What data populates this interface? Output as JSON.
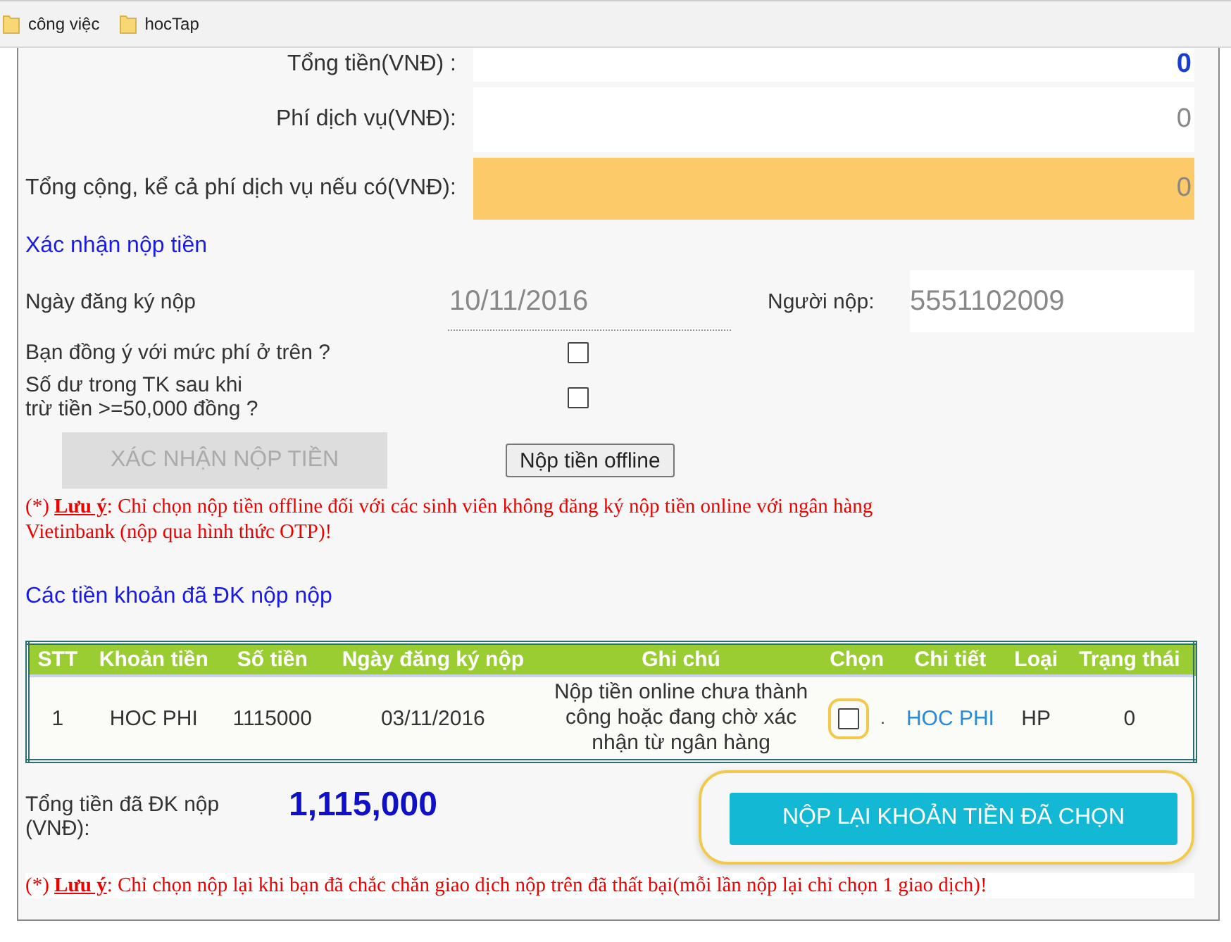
{
  "bookmarks": [
    {
      "label": "công việc"
    },
    {
      "label": "hocTap"
    }
  ],
  "amount_rows": [
    {
      "label": "Tổng tiền(VNĐ) :",
      "value": "0",
      "kind": "plain"
    },
    {
      "label": "Phí dịch vụ(VNĐ):",
      "value": "0",
      "kind": "plain"
    },
    {
      "label": "Tổng cộng, kể cả phí dịch vụ nếu có(VNĐ):",
      "value": "0",
      "kind": "total"
    }
  ],
  "confirm_heading": "Xác nhận nộp tiền",
  "register_date": {
    "label": "Ngày đăng ký nộp",
    "value": "10/11/2016"
  },
  "payer": {
    "label": "Người nộp:",
    "value": "5551102009"
  },
  "agreements": [
    {
      "label": "Bạn đồng ý với mức phí ở trên ?",
      "checked": false
    },
    {
      "label": "Số dư trong TK sau khi\ntrừ tiền >=50,000 đồng ?",
      "checked": false
    }
  ],
  "confirm_button": {
    "label": "XÁC NHẬN NỘP TIỀN",
    "disabled": true
  },
  "offline_button": {
    "label": "Nộp tiền offline",
    "disabled": false
  },
  "note_1": "(*) **Lưu ý**: Chỉ chọn nộp tiền offline đối với các sinh viên không đăng ký nộp tiền online với ngân hàng Vietinbank (nộp qua hình thức OTP)!",
  "registered_heading": "Các tiền khoản đã ĐK nộp nộp",
  "table": {
    "columns": [
      "STT",
      "Khoản tiền",
      "Số tiền",
      "Ngày đăng ký nộp",
      "Ghi chú",
      "Chọn",
      "Chi tiết",
      "Loại",
      "Trạng thái"
    ],
    "rows": [
      {
        "stt": "1",
        "item": "HOC PHI",
        "amount": "1115000",
        "date": "03/11/2016",
        "note": "Nộp tiền online chưa thành công hoặc đang chờ xác nhận từ ngân hàng",
        "checked": false,
        "highlighted": true,
        "separator": ".",
        "detail": "HOC PHI",
        "type": "HP",
        "status": "0"
      }
    ]
  },
  "total": {
    "label": "Tổng tiền đã ĐK nộp\n(VNĐ):",
    "value": "1,115,000"
  },
  "resubmit_button": {
    "label": "NỘP LẠI KHOẢN TIỀN ĐÃ CHỌN",
    "highlighted": true
  },
  "note_2": "(*) **Lưu ý**: Chỉ chọn nộp lại khi bạn đã chắc chắn giao dịch nộp trên đã thất bại(mỗi lần nộp lại chỉ chọn 1 giao dịch)!"
}
